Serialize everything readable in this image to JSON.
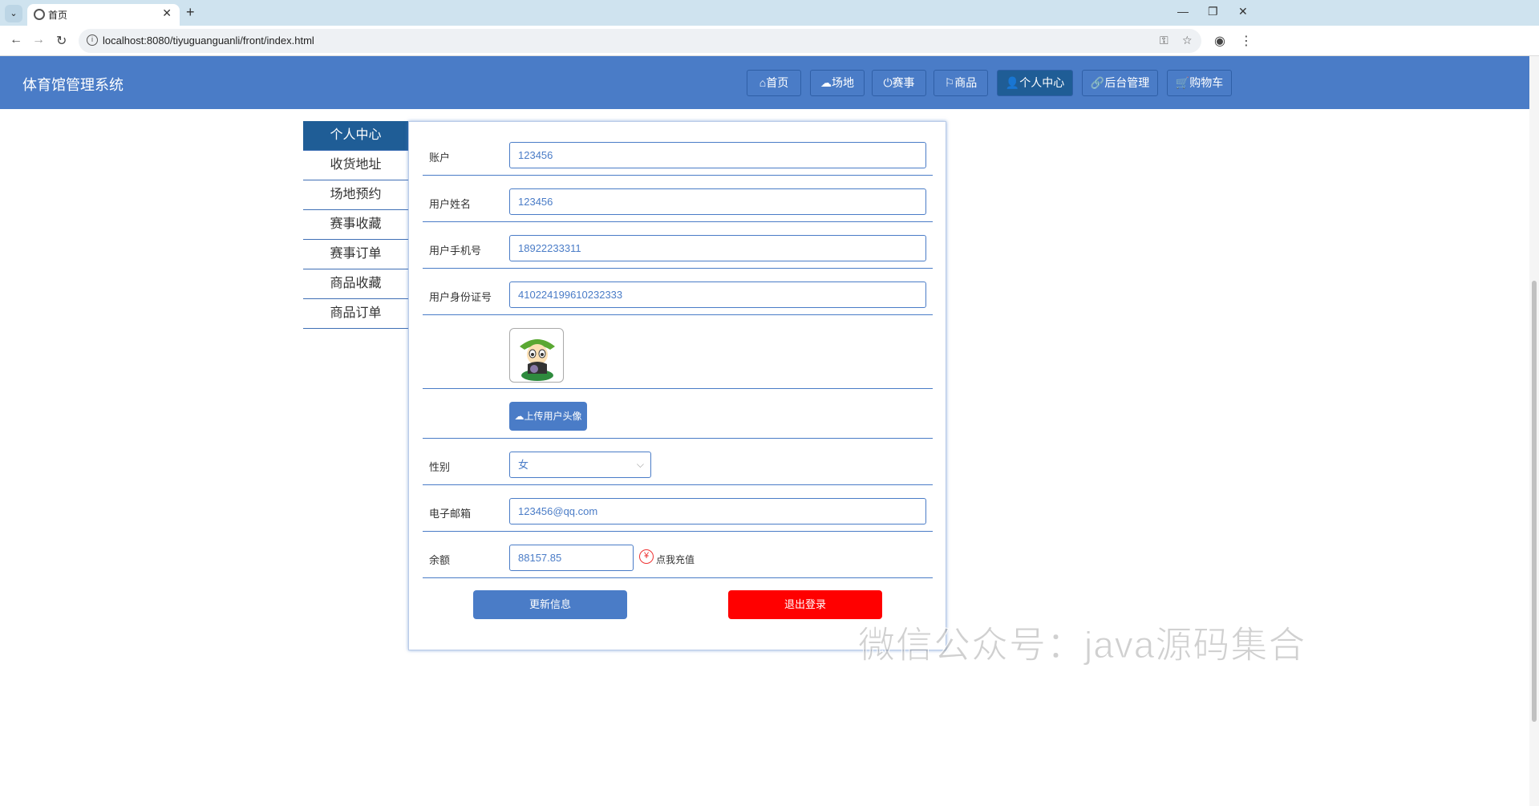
{
  "browser": {
    "tab_title": "首页",
    "url": "localhost:8080/tiyuguanguanli/front/index.html"
  },
  "header": {
    "brand": "体育馆管理系统",
    "nav": [
      {
        "label": "首页",
        "icon": "home-icon"
      },
      {
        "label": "场地",
        "icon": "cloud-icon"
      },
      {
        "label": "赛事",
        "icon": "power-icon"
      },
      {
        "label": "商品",
        "icon": "flag-icon"
      },
      {
        "label": "个人中心",
        "icon": "user-icon"
      },
      {
        "label": "后台管理",
        "icon": "link-icon"
      },
      {
        "label": "购物车",
        "icon": "cart-icon"
      }
    ],
    "active_nav": "个人中心"
  },
  "sidebar": {
    "items": [
      "个人中心",
      "收货地址",
      "场地预约",
      "赛事收藏",
      "赛事订单",
      "商品收藏",
      "商品订单"
    ],
    "active": "个人中心"
  },
  "form": {
    "account_label": "账户",
    "account_value": "123456",
    "name_label": "用户姓名",
    "name_value": "123456",
    "phone_label": "用户手机号",
    "phone_value": "18922233311",
    "idcard_label": "用户身份证号",
    "idcard_value": "410224199610232333",
    "upload_label": "上传用户头像",
    "gender_label": "性别",
    "gender_value": "女",
    "email_label": "电子邮箱",
    "email_value": "123456@qq.com",
    "balance_label": "余额",
    "balance_value": "88157.85",
    "recharge_label": "点我充值",
    "update_button": "更新信息",
    "logout_button": "退出登录"
  },
  "colors": {
    "primary": "#4a7cc7",
    "active": "#1f5d96",
    "danger": "#ff0000"
  },
  "watermark": "微信公众号：java源码集合"
}
